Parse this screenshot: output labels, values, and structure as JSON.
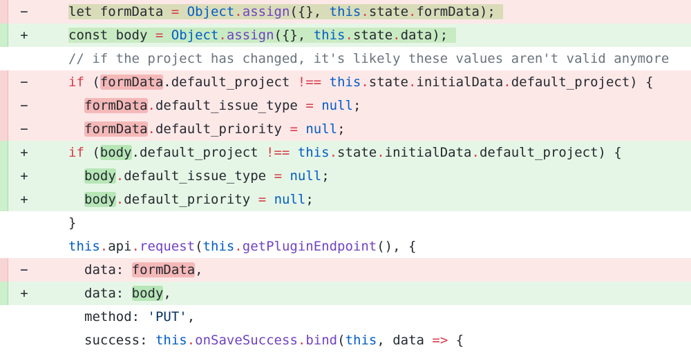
{
  "markers": {
    "del": "−",
    "add": "+"
  },
  "lines": {
    "l0": {
      "kw": "let",
      "var": "formData",
      "eq": "=",
      "obj": "Object",
      "dot1": ".",
      "fn": "assign",
      "args": "({}, ",
      "this": "this",
      "dot2": ".",
      "state": "state",
      "dot3": ".",
      "prop": "formData",
      "end": ");"
    },
    "l1": {
      "kw": "const",
      "var": "body",
      "eq": "=",
      "obj": "Object",
      "dot1": ".",
      "fn": "assign",
      "args": "({}, ",
      "this": "this",
      "dot2": ".",
      "state": "state",
      "dot3": ".",
      "prop": "data",
      "end": ");"
    },
    "l2": {
      "comment": "// if the project has changed, it's likely these values aren't valid anymore"
    },
    "l3": {
      "kw": "if",
      "open": " (",
      "var": "formData",
      "rest1": ".default_project ",
      "op": "!==",
      "sp": " ",
      "this": "this",
      "dot": ".",
      "rest2": "state",
      "dot2": ".",
      "rest3": "initialData",
      "dot3": ".",
      "rest4": "default_project) {"
    },
    "l4": {
      "var": "formData",
      "dot": ".",
      "prop": "default_issue_type ",
      "eq": "=",
      "sp": " ",
      "null": "null",
      "end": ";"
    },
    "l5": {
      "var": "formData",
      "dot": ".",
      "prop": "default_priority ",
      "eq": "=",
      "sp": " ",
      "null": "null",
      "end": ";"
    },
    "l6": {
      "kw": "if",
      "open": " (",
      "var": "body",
      "rest1": ".default_project ",
      "op": "!==",
      "sp": " ",
      "this": "this",
      "dot": ".",
      "rest2": "state",
      "dot2": ".",
      "rest3": "initialData",
      "dot3": ".",
      "rest4": "default_project) {"
    },
    "l7": {
      "var": "body",
      "dot": ".",
      "prop": "default_issue_type ",
      "eq": "=",
      "sp": " ",
      "null": "null",
      "end": ";"
    },
    "l8": {
      "var": "body",
      "dot": ".",
      "prop": "default_priority ",
      "eq": "=",
      "sp": " ",
      "null": "null",
      "end": ";"
    },
    "l9": {
      "text": "}"
    },
    "l10": {
      "this": "this",
      "dot": ".",
      "api": "api",
      "dot2": ".",
      "fn": "request",
      "open": "(",
      "this2": "this",
      "dot3": ".",
      "fn2": "getPluginEndpoint",
      "rest": "(), {"
    },
    "l11": {
      "key": "data: ",
      "var": "formData",
      "end": ","
    },
    "l12": {
      "key": "data: ",
      "var": "body",
      "end": ","
    },
    "l13": {
      "key": "method: ",
      "str": "'PUT'",
      "end": ","
    },
    "l14": {
      "key": "success: ",
      "this": "this",
      "dot": ".",
      "fn": "onSaveSuccess",
      "dot2": ".",
      "fn2": "bind",
      "open": "(",
      "this2": "this",
      "rest": ", data ",
      "arrow": "=>",
      "end": " {"
    }
  }
}
